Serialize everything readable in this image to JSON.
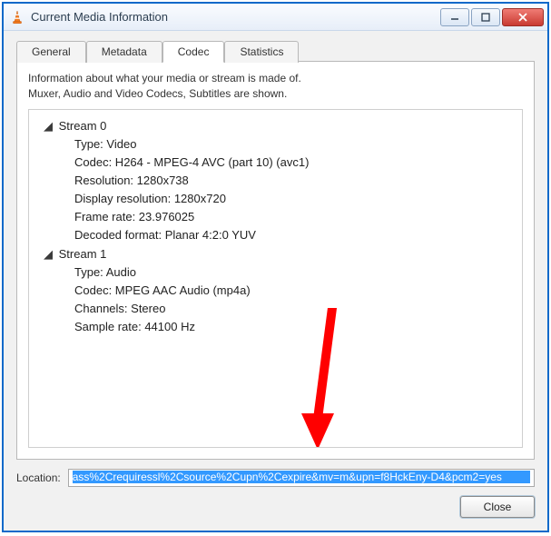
{
  "titlebar": {
    "title": "Current Media Information"
  },
  "tabs": {
    "items": [
      {
        "label": "General"
      },
      {
        "label": "Metadata"
      },
      {
        "label": "Codec"
      },
      {
        "label": "Statistics"
      }
    ],
    "active_index": 2
  },
  "codec_page": {
    "info_line1": "Information about what your media or stream is made of.",
    "info_line2": "Muxer, Audio and Video Codecs, Subtitles are shown.",
    "streams": [
      {
        "title": "Stream 0",
        "rows": [
          "Type: Video",
          "Codec: H264 - MPEG-4 AVC (part 10) (avc1)",
          "Resolution: 1280x738",
          "Display resolution: 1280x720",
          "Frame rate: 23.976025",
          "Decoded format: Planar 4:2:0 YUV"
        ]
      },
      {
        "title": "Stream 1",
        "rows": [
          "Type: Audio",
          "Codec: MPEG AAC Audio (mp4a)",
          "Channels: Stereo",
          "Sample rate: 44100 Hz"
        ]
      }
    ]
  },
  "location": {
    "label": "Location:",
    "value": "ass%2Crequiressl%2Csource%2Cupn%2Cexpire&mv=m&upn=f8HckEny-D4&pcm2=yes"
  },
  "buttons": {
    "close": "Close"
  },
  "overlay": {
    "annotation_arrow_color": "#ff0000"
  }
}
